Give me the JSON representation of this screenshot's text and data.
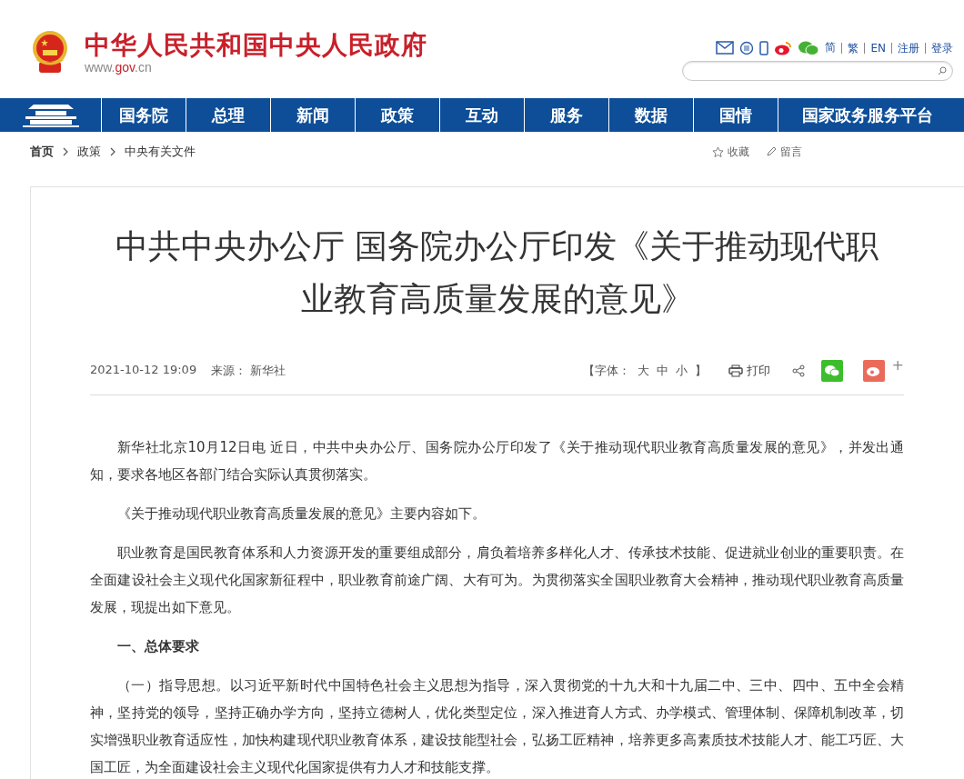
{
  "header": {
    "site_name": "中华人民共和国中央人民政府",
    "domain_prefix": "www.",
    "domain_main": "gov",
    "domain_suffix": ".cn",
    "top_links": [
      "简",
      "繁",
      "EN",
      "注册",
      "登录"
    ]
  },
  "nav": {
    "items": [
      {
        "label": "国务院"
      },
      {
        "label": "总理"
      },
      {
        "label": "新闻"
      },
      {
        "label": "政策"
      },
      {
        "label": "互动"
      },
      {
        "label": "服务"
      },
      {
        "label": "数据"
      },
      {
        "label": "国情"
      },
      {
        "label": "国家政务服务平台"
      }
    ]
  },
  "breadcrumb": [
    "首页",
    "政策",
    "中央有关文件"
  ],
  "page_actions": [
    "收藏",
    "留言"
  ],
  "article": {
    "title": "中共中央办公厅 国务院办公厅印发《关于推动现代职业教育高质量发展的意见》",
    "date": "2021-10-12 19:09",
    "source_label": "来源：",
    "source": "新华社",
    "font_label": "【字体：",
    "font_sizes": [
      "大",
      "中",
      "小"
    ],
    "font_close": "】",
    "print": "打印",
    "more": "+",
    "paragraphs": [
      {
        "kind": "text",
        "text": "新华社北京10月12日电 近日，中共中央办公厅、国务院办公厅印发了《关于推动现代职业教育高质量发展的意见》，并发出通知，要求各地区各部门结合实际认真贯彻落实。"
      },
      {
        "kind": "text",
        "text": "《关于推动现代职业教育高质量发展的意见》主要内容如下。"
      },
      {
        "kind": "text",
        "text": "职业教育是国民教育体系和人力资源开发的重要组成部分，肩负着培养多样化人才、传承技术技能、促进就业创业的重要职责。在全面建设社会主义现代化国家新征程中，职业教育前途广阔、大有可为。为贯彻落实全国职业教育大会精神，推动现代职业教育高质量发展，现提出如下意见。"
      },
      {
        "kind": "heading",
        "text": "一、总体要求"
      },
      {
        "kind": "text",
        "text": "（一）指导思想。以习近平新时代中国特色社会主义思想为指导，深入贯彻党的十九大和十九届二中、三中、四中、五中全会精神，坚持党的领导，坚持正确办学方向，坚持立德树人，优化类型定位，深入推进育人方式、办学模式、管理体制、保障机制改革，切实增强职业教育适应性，加快构建现代职业教育体系，建设技能型社会，弘扬工匠精神，培养更多高素质技术技能人才、能工巧匠、大国工匠，为全面建设社会主义现代化国家提供有力人才和技能支撑。"
      }
    ]
  }
}
